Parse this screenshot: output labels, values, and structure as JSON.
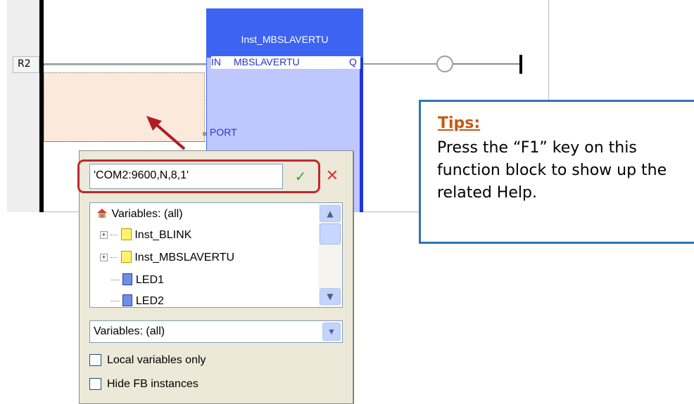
{
  "ladder": {
    "rung_label": "R2",
    "fb_instance": "Inst_MBSLAVERTU",
    "fb_in": "IN",
    "fb_type": "MBSLAVERTU",
    "fb_out": "Q",
    "fb_port": "PORT"
  },
  "popup": {
    "value": "'COM2:9600,N,8,1'",
    "ok_icon": "checkmark-icon",
    "cancel_icon": "cross-icon",
    "tree": {
      "root": "Variables: (all)",
      "items": [
        "Inst_BLINK",
        "Inst_MBSLAVERTU",
        "LED1",
        "LED2"
      ]
    },
    "filter": "Variables: (all)",
    "checkboxes": [
      {
        "label": "Local variables only",
        "checked": false
      },
      {
        "label": "Hide FB instances",
        "checked": false
      }
    ]
  },
  "tips": {
    "title": "Tips:",
    "body": "Press the “F1” key on this function block to show up the related Help."
  },
  "colors": {
    "fb_header": "#3d63f2",
    "fb_body": "#bfc7ff",
    "highlight": "#c0272d",
    "tips_border": "#2e75b6",
    "tips_title": "#c55a11"
  }
}
